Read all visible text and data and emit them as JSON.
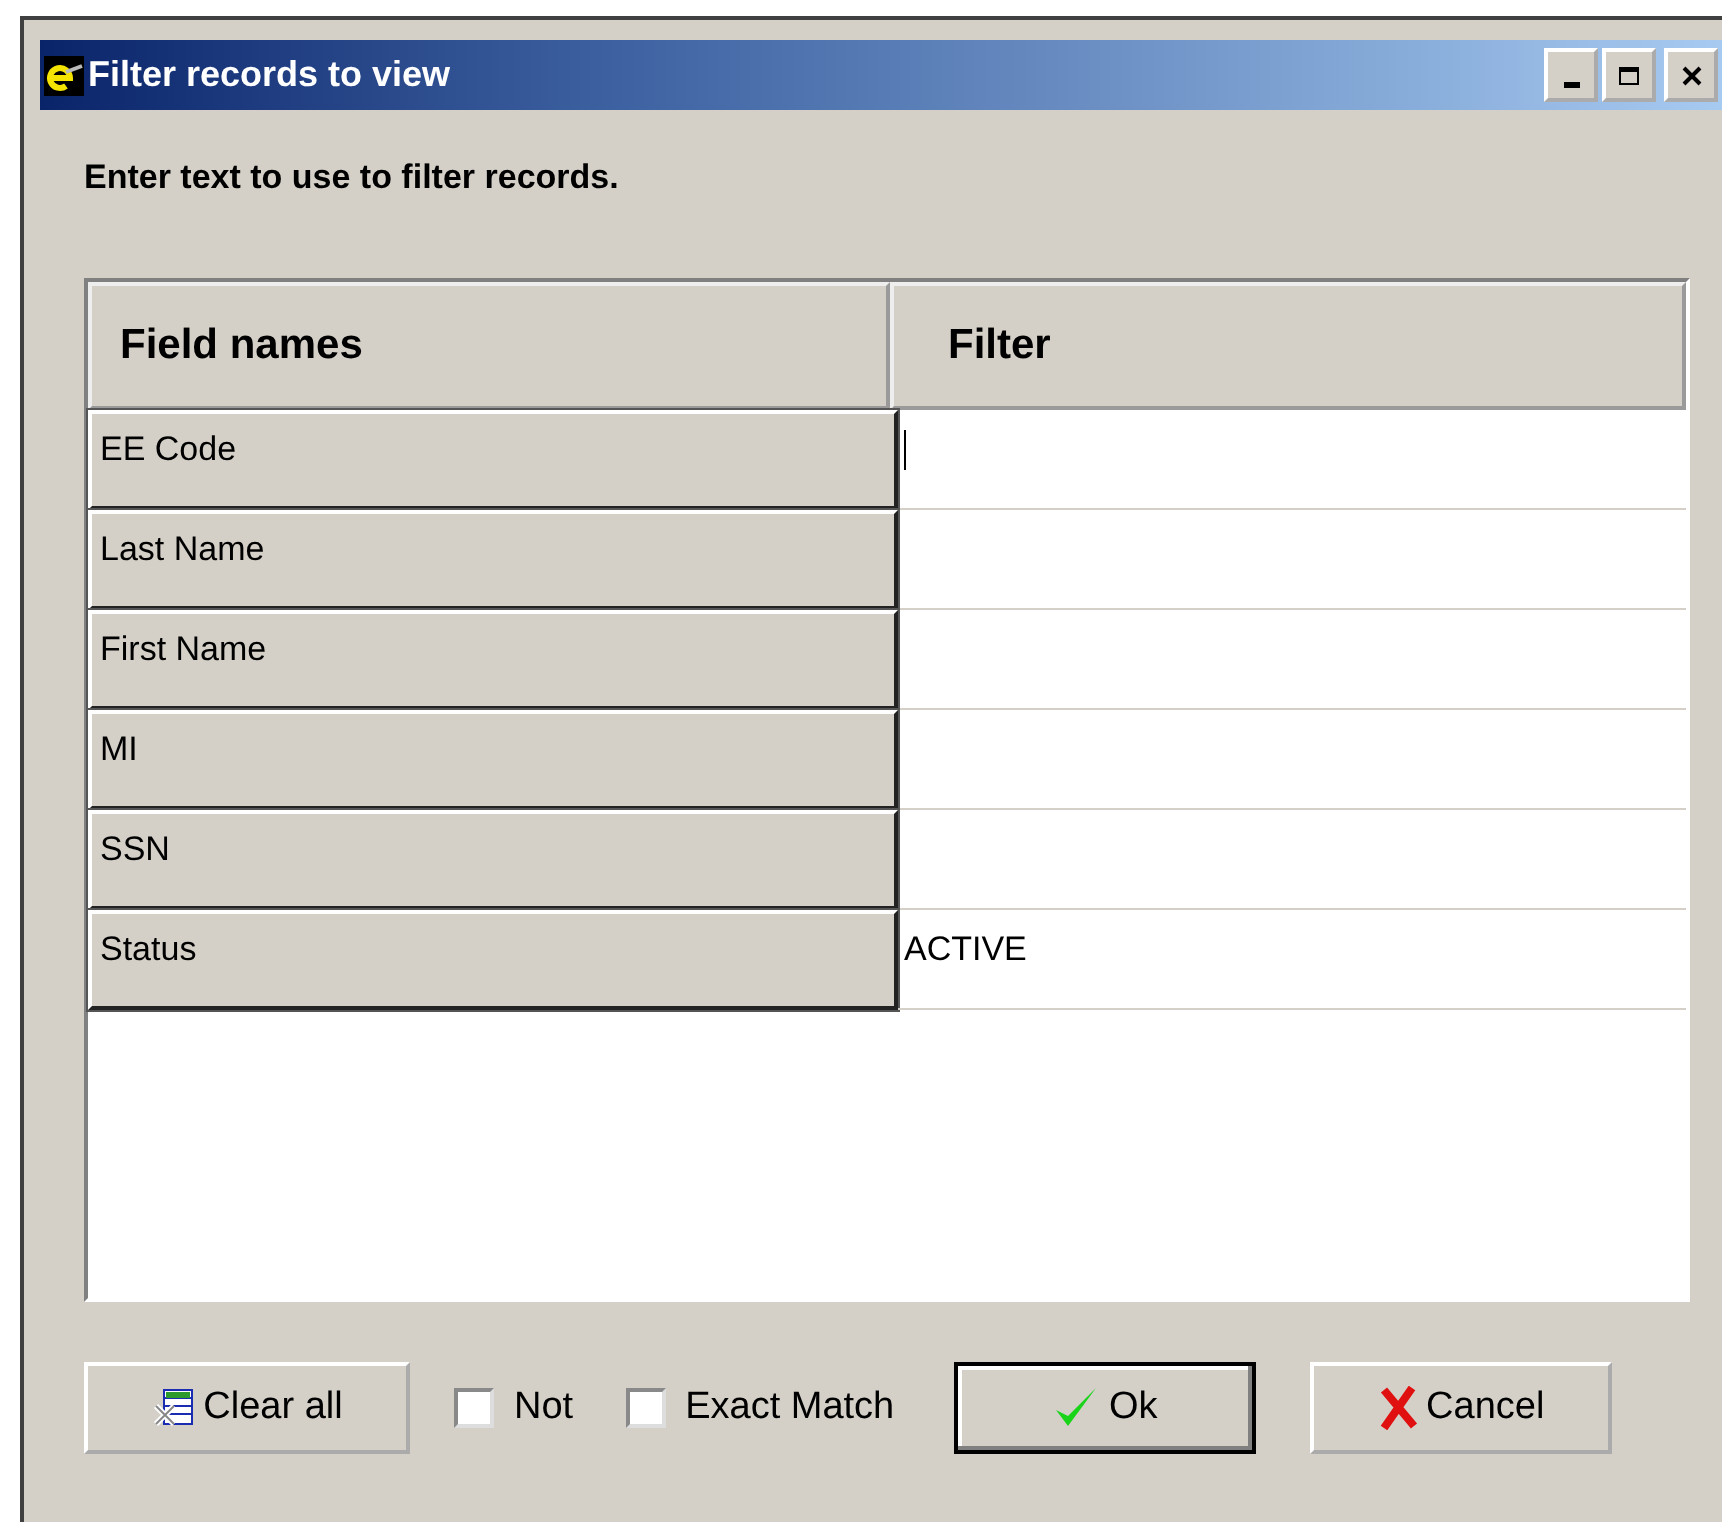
{
  "window": {
    "title": "Filter records to view"
  },
  "instruction": "Enter text to use to filter records.",
  "columns": [
    "Field names",
    "Filter"
  ],
  "rows": [
    {
      "field": "EE Code",
      "focused": true
    },
    {
      "field": "Last Name",
      "focused": false
    },
    {
      "field": "First Name",
      "focused": false
    },
    {
      "field": "MI",
      "focused": false
    },
    {
      "field": "SSN",
      "focused": false
    },
    {
      "field": "Status",
      "value": "ACTIVE",
      "focused": false
    }
  ],
  "clear_button": "Clear all",
  "options": [
    {
      "label": "Not",
      "checked": false
    },
    {
      "label": "Exact Match",
      "checked": false
    }
  ],
  "ok_button": "Ok",
  "cancel_button": "Cancel"
}
